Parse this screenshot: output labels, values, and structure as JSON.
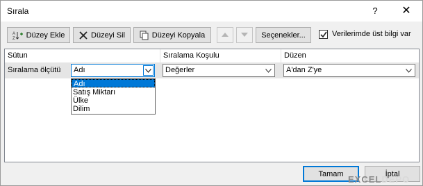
{
  "window": {
    "title": "Sırala",
    "help": "?",
    "close": "✕"
  },
  "toolbar": {
    "add_level": "Düzey Ekle",
    "delete_level": "Düzeyi Sil",
    "copy_level": "Düzeyi Kopyala",
    "options": "Seçenekler...",
    "header_checkbox_label": "Verilerimde üst bilgi var",
    "header_checkbox_checked": true
  },
  "grid": {
    "columns": [
      "Sütun",
      "Sıralama Koşulu",
      "Düzen"
    ],
    "row": {
      "label": "Sıralama ölçütü",
      "column_value": "Adı",
      "sort_on_value": "Değerler",
      "order_value": "A'dan Z'ye"
    },
    "dropdown_options": [
      "Adı",
      "Satış Miktarı",
      "Ülke",
      "Dilim"
    ],
    "dropdown_selected": "Adı"
  },
  "footer": {
    "ok": "Tamam",
    "cancel": "İptal"
  },
  "watermark": {
    "part1": "EXCEL",
    "part2": "DEPO"
  }
}
